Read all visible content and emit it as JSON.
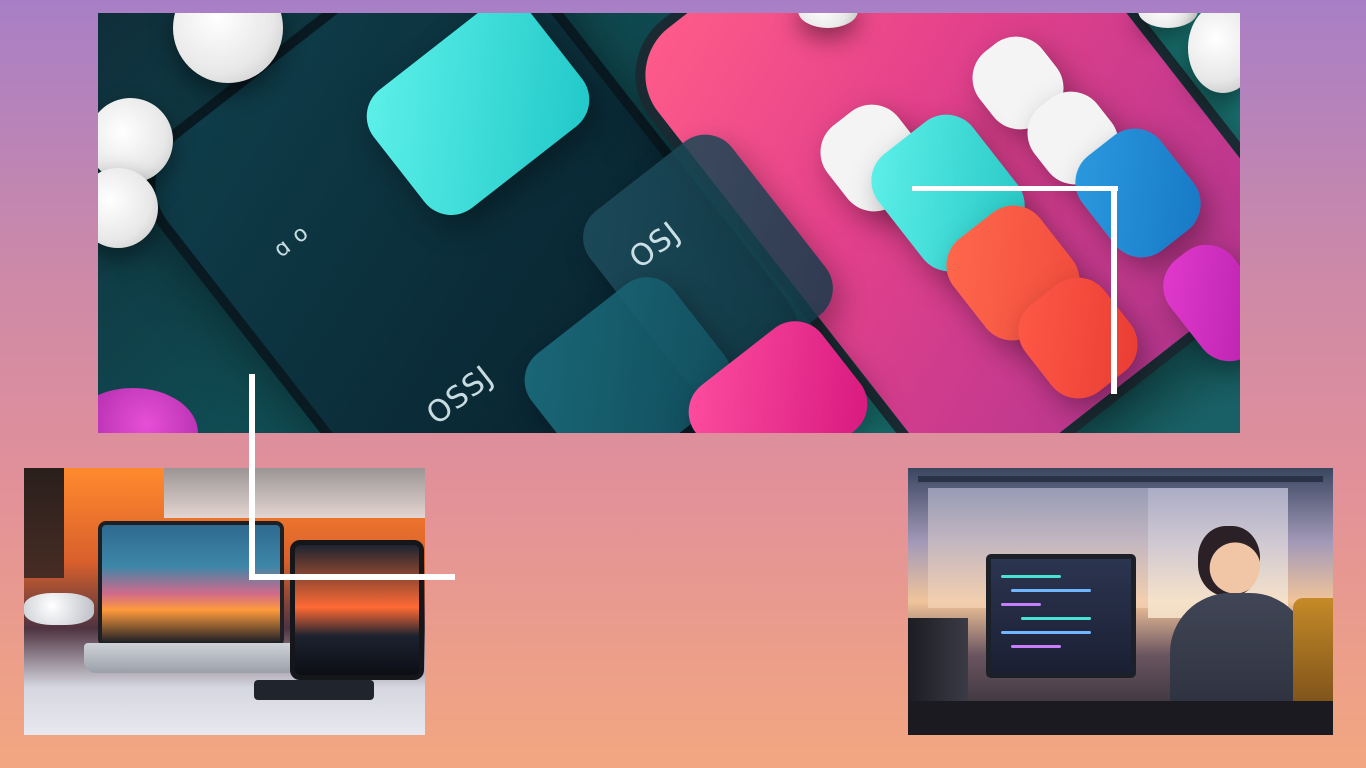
{
  "hero": {
    "name": "featured-apps-artwork",
    "glyph_main": "OSSJ",
    "glyph_secondary": "OSJ",
    "glyph_small": "ɑ o"
  },
  "gallery": {
    "left_photo": "workspace-laptop-tablet-photo",
    "right_photo": "person-coding-at-window-photo"
  },
  "colors": {
    "background_top": "#a87fc6",
    "background_bottom": "#f3a780",
    "accent_cyan": "#1fc7c8",
    "accent_pink": "#e4418b",
    "accent_red": "#f04a3c",
    "connector": "#ffffff"
  }
}
